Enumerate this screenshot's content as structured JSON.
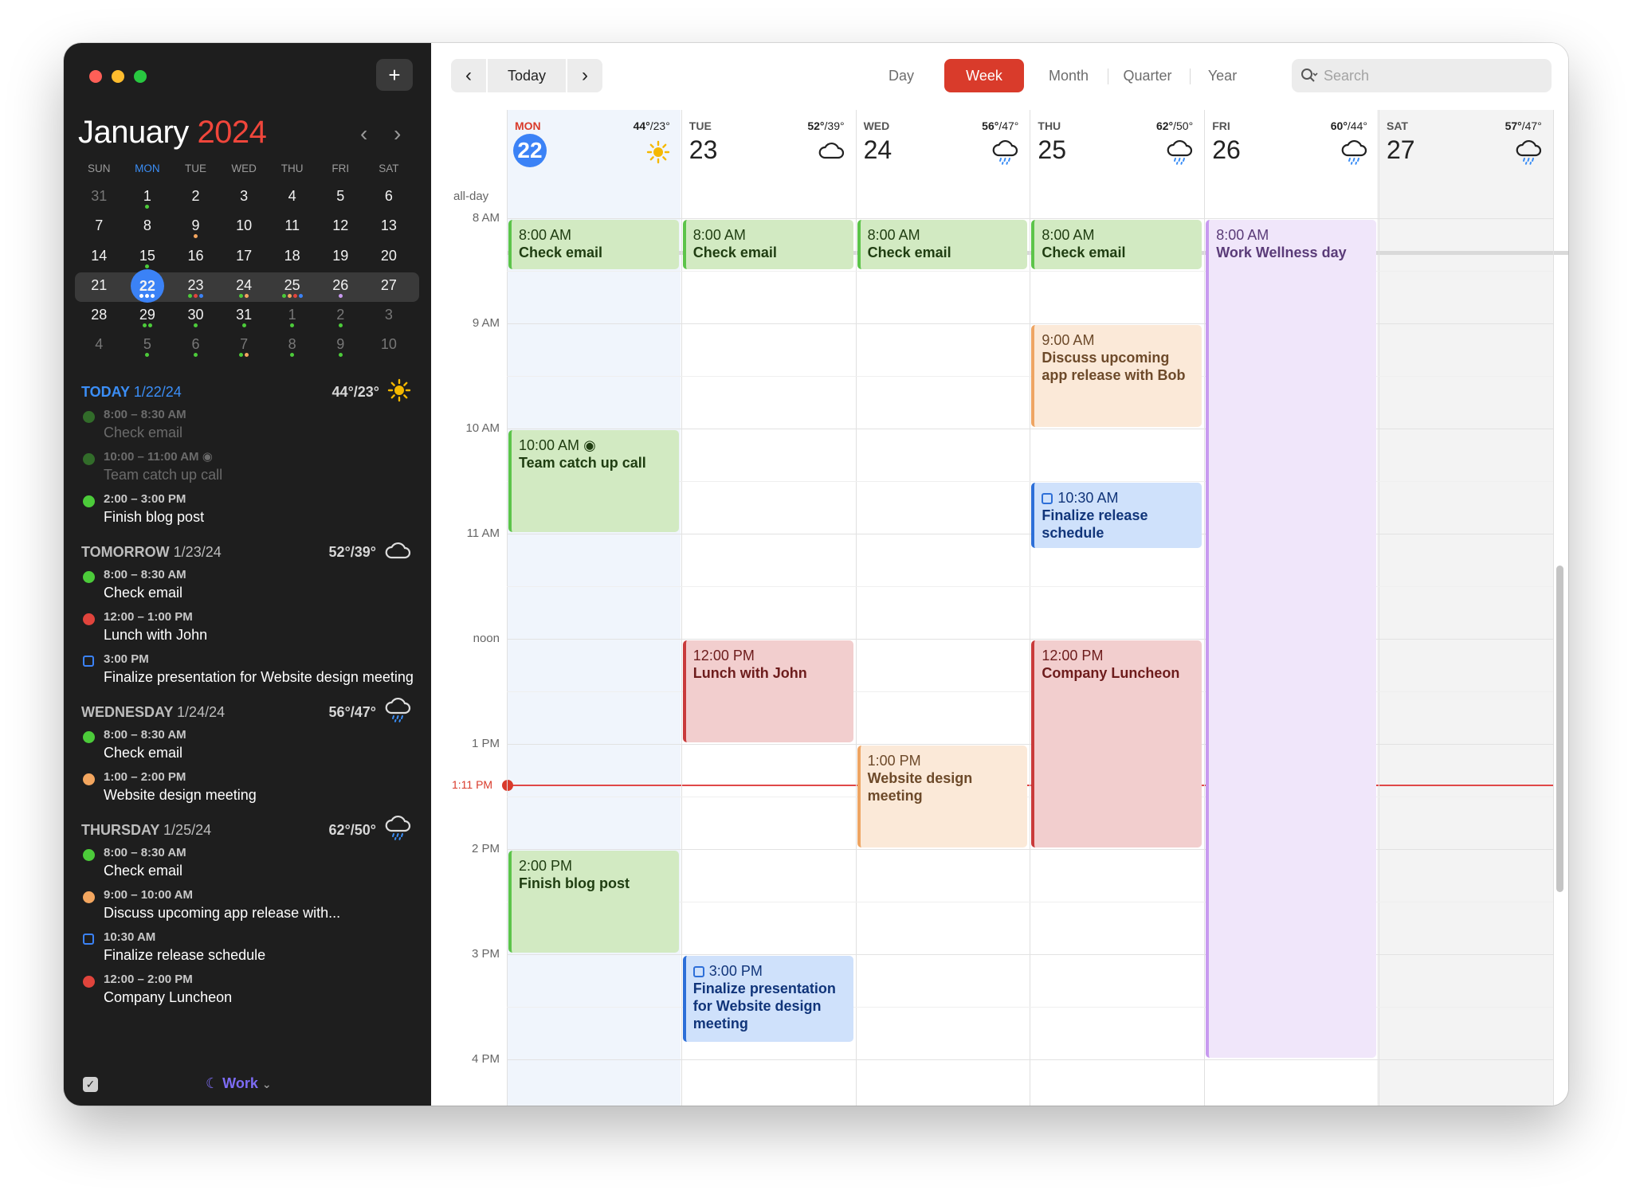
{
  "window": {
    "controls": [
      "close",
      "minimize",
      "zoom"
    ]
  },
  "sidebar": {
    "add_label": "+",
    "month": "January",
    "year": "2024",
    "weekdays": [
      "SUN",
      "MON",
      "TUE",
      "WED",
      "THU",
      "FRI",
      "SAT"
    ],
    "weeks": [
      [
        "31",
        "1",
        "2",
        "3",
        "4",
        "5",
        "6"
      ],
      [
        "7",
        "8",
        "9",
        "10",
        "11",
        "12",
        "13"
      ],
      [
        "14",
        "15",
        "16",
        "17",
        "18",
        "19",
        "20"
      ],
      [
        "21",
        "22",
        "23",
        "24",
        "25",
        "26",
        "27"
      ],
      [
        "28",
        "29",
        "30",
        "31",
        "1",
        "2",
        "3"
      ],
      [
        "4",
        "5",
        "6",
        "7",
        "8",
        "9",
        "10"
      ]
    ],
    "agenda": [
      {
        "label": "TODAY",
        "date": "1/22/24",
        "temp": "44°/23°",
        "icon": "sun-icon",
        "items": [
          {
            "time": "8:00 – 8:30 AM",
            "title": "Check email",
            "color": "#4ccb3a",
            "kind": "dot",
            "past": true
          },
          {
            "time": "10:00 – 11:00 AM",
            "title": "Team catch up call",
            "color": "#4ccb3a",
            "kind": "dot",
            "past": true
          },
          {
            "time": "2:00 – 3:00 PM",
            "title": "Finish blog post",
            "color": "#4ccb3a",
            "kind": "dot"
          }
        ]
      },
      {
        "label": "TOMORROW",
        "date": "1/23/24",
        "temp": "52°/39°",
        "icon": "cloud-icon",
        "items": [
          {
            "time": "8:00 – 8:30 AM",
            "title": "Check email",
            "color": "#4ccb3a",
            "kind": "dot"
          },
          {
            "time": "12:00 – 1:00 PM",
            "title": "Lunch with John",
            "color": "#e0443c",
            "kind": "dot"
          },
          {
            "time": "3:00 PM",
            "title": "Finalize presentation for Website design meeting",
            "color": "#3b82f6",
            "kind": "box"
          }
        ]
      },
      {
        "label": "WEDNESDAY",
        "date": "1/24/24",
        "temp": "56°/47°",
        "icon": "rain-icon",
        "items": [
          {
            "time": "8:00 – 8:30 AM",
            "title": "Check email",
            "color": "#4ccb3a",
            "kind": "dot"
          },
          {
            "time": "1:00 – 2:00 PM",
            "title": "Website design meeting",
            "color": "#f3a65f",
            "kind": "dot"
          }
        ]
      },
      {
        "label": "THURSDAY",
        "date": "1/25/24",
        "temp": "62°/50°",
        "icon": "rain-icon",
        "items": [
          {
            "time": "8:00 – 8:30 AM",
            "title": "Check email",
            "color": "#4ccb3a",
            "kind": "dot"
          },
          {
            "time": "9:00 – 10:00 AM",
            "title": "Discuss upcoming app release with...",
            "color": "#f3a65f",
            "kind": "dot"
          },
          {
            "time": "10:30 AM",
            "title": "Finalize release schedule",
            "color": "#3b82f6",
            "kind": "box"
          },
          {
            "time": "12:00 – 2:00 PM",
            "title": "Company Luncheon",
            "color": "#e0443c",
            "kind": "dot"
          }
        ]
      }
    ],
    "calendar_set": "Work"
  },
  "toolbar": {
    "prev": "‹",
    "today": "Today",
    "next": "›",
    "views": [
      "Day",
      "Week",
      "Month",
      "Quarter",
      "Year"
    ],
    "active_view": "Week",
    "search_placeholder": "Search"
  },
  "week": {
    "allday_label": "all-day",
    "days": [
      {
        "name": "MON",
        "date": "22",
        "hi": "44°",
        "lo": "/23°",
        "icon": "sun-icon",
        "today": true
      },
      {
        "name": "TUE",
        "date": "23",
        "hi": "52°",
        "lo": "/39°",
        "icon": "cloud-icon"
      },
      {
        "name": "WED",
        "date": "24",
        "hi": "56°",
        "lo": "/47°",
        "icon": "rain-icon"
      },
      {
        "name": "THU",
        "date": "25",
        "hi": "62°",
        "lo": "/50°",
        "icon": "rain-icon"
      },
      {
        "name": "FRI",
        "date": "26",
        "hi": "60°",
        "lo": "/44°",
        "icon": "rain-icon"
      },
      {
        "name": "SAT",
        "date": "27",
        "hi": "57°",
        "lo": "/47°",
        "icon": "rain-icon"
      }
    ],
    "hours": [
      "8 AM",
      "9 AM",
      "10 AM",
      "11 AM",
      "noon",
      "1 PM",
      "2 PM",
      "3 PM",
      "4 PM"
    ],
    "now_label": "1:11 PM",
    "events": [
      {
        "day": 0,
        "start": 8,
        "end": 8.5,
        "time": "8:00 AM",
        "title": "Check email",
        "color": "green"
      },
      {
        "day": 1,
        "start": 8,
        "end": 8.5,
        "time": "8:00 AM",
        "title": "Check email",
        "color": "green"
      },
      {
        "day": 2,
        "start": 8,
        "end": 8.5,
        "time": "8:00 AM",
        "title": "Check email",
        "color": "green"
      },
      {
        "day": 3,
        "start": 8,
        "end": 8.5,
        "time": "8:00 AM",
        "title": "Check email",
        "color": "green"
      },
      {
        "day": 4,
        "start": 8,
        "end": 16,
        "time": "8:00 AM",
        "title": "Work Wellness day",
        "color": "purple"
      },
      {
        "day": 3,
        "start": 9,
        "end": 10,
        "time": "9:00 AM",
        "title": "Discuss upcoming app release with Bob",
        "color": "orange"
      },
      {
        "day": 0,
        "start": 10,
        "end": 11,
        "time": "10:00 AM",
        "title": "Team catch up call",
        "color": "green",
        "video": true
      },
      {
        "day": 3,
        "start": 10.5,
        "end": 11.15,
        "time": "10:30 AM",
        "title": "Finalize release schedule",
        "color": "blue",
        "task": true
      },
      {
        "day": 1,
        "start": 12,
        "end": 13,
        "time": "12:00 PM",
        "title": "Lunch with John",
        "color": "red"
      },
      {
        "day": 3,
        "start": 12,
        "end": 14,
        "time": "12:00 PM",
        "title": "Company Luncheon",
        "color": "red"
      },
      {
        "day": 2,
        "start": 13,
        "end": 14,
        "time": "1:00 PM",
        "title": "Website design meeting",
        "color": "orange"
      },
      {
        "day": 0,
        "start": 14,
        "end": 15,
        "time": "2:00 PM",
        "title": "Finish blog post",
        "color": "green"
      },
      {
        "day": 1,
        "start": 15,
        "end": 15.85,
        "time": "3:00 PM",
        "title": "Finalize presentation for Website design meeting",
        "color": "blue",
        "task": true
      }
    ]
  }
}
